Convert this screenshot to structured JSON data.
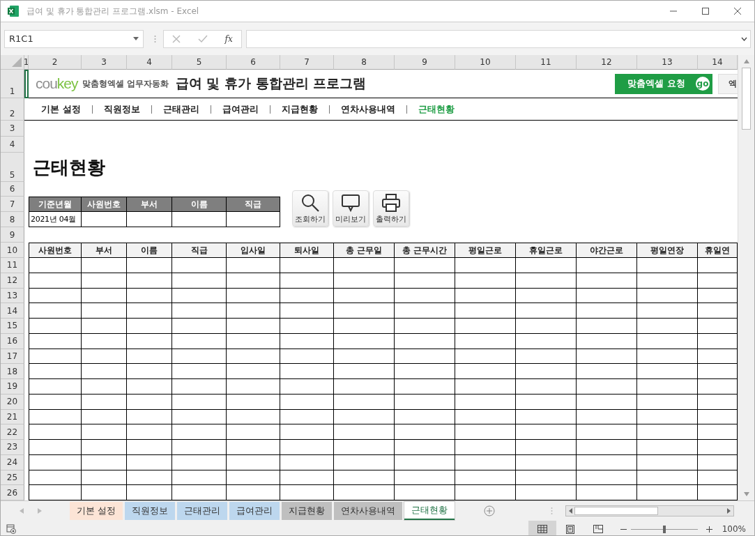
{
  "window": {
    "title": "급여 및 휴가 통합관리 프로그램.xlsm - Excel"
  },
  "formula_bar": {
    "name_box": "R1C1",
    "function_label": "fx"
  },
  "column_headers": [
    "1",
    "2",
    "3",
    "4",
    "5",
    "6",
    "7",
    "8",
    "9",
    "10",
    "11",
    "12",
    "13",
    "14"
  ],
  "row_headers": [
    "1",
    "2",
    "3",
    "4",
    "5",
    "6",
    "7",
    "8",
    "9",
    "10",
    "11",
    "12",
    "13",
    "14",
    "15",
    "16",
    "17",
    "18",
    "19",
    "20",
    "21",
    "22",
    "23",
    "24",
    "25",
    "26"
  ],
  "banner": {
    "logo_parts": [
      "cou",
      "key"
    ],
    "tagline": "맞춤형엑셀 업무자동화",
    "title": "급여 및 휴가 통합관리 프로그램",
    "request_button": "맞춤엑셀 요청",
    "go_badge": "go",
    "cut_button": "엑"
  },
  "nav": [
    {
      "label": "기본 설정",
      "selected": false
    },
    {
      "label": "직원정보",
      "selected": false
    },
    {
      "label": "근태관리",
      "selected": false
    },
    {
      "label": "급여관리",
      "selected": false
    },
    {
      "label": "지급현황",
      "selected": false
    },
    {
      "label": "연차사용내역",
      "selected": false
    },
    {
      "label": "근태현황",
      "selected": true
    }
  ],
  "page_title": "근태현황",
  "filter": [
    {
      "label": "기준년월",
      "value": "2021년 04월"
    },
    {
      "label": "사원번호"
    },
    {
      "label": "부서"
    },
    {
      "label": "이름"
    },
    {
      "label": "직급"
    }
  ],
  "actions": [
    {
      "label": "조회하기",
      "kind": "search"
    },
    {
      "label": "미리보기",
      "kind": "preview"
    },
    {
      "label": "출력하기",
      "kind": "print"
    }
  ],
  "table": {
    "columns": [
      "사원번호",
      "부서",
      "이름",
      "직급",
      "입사일",
      "퇴사일",
      "총 근무일",
      "총 근무시간",
      "평일근로",
      "휴일근로",
      "야간근로",
      "평일연장",
      "휴일연"
    ]
  },
  "sheet_tabs": [
    {
      "label": "기본 설정",
      "color": "#fce4d6",
      "selected": false
    },
    {
      "label": "직원정보",
      "color": "#bdd7ee",
      "selected": false
    },
    {
      "label": "근태관리",
      "color": "#bdd7ee",
      "selected": false
    },
    {
      "label": "급여관리",
      "color": "#bdd7ee",
      "selected": false
    },
    {
      "label": "지급현황",
      "color": "#bfbfbf",
      "selected": false
    },
    {
      "label": "연차사용내역",
      "color": "#bfbfbf",
      "selected": false
    },
    {
      "label": "근태현황",
      "color": "#ffffff",
      "selected": true
    }
  ],
  "status_bar": {
    "views": [
      {
        "kind": "normal",
        "selected": true
      },
      {
        "kind": "layout",
        "selected": false
      },
      {
        "kind": "pagebreak",
        "selected": false
      }
    ],
    "zoom": {
      "level": 0.5,
      "reading": "100%"
    }
  }
}
